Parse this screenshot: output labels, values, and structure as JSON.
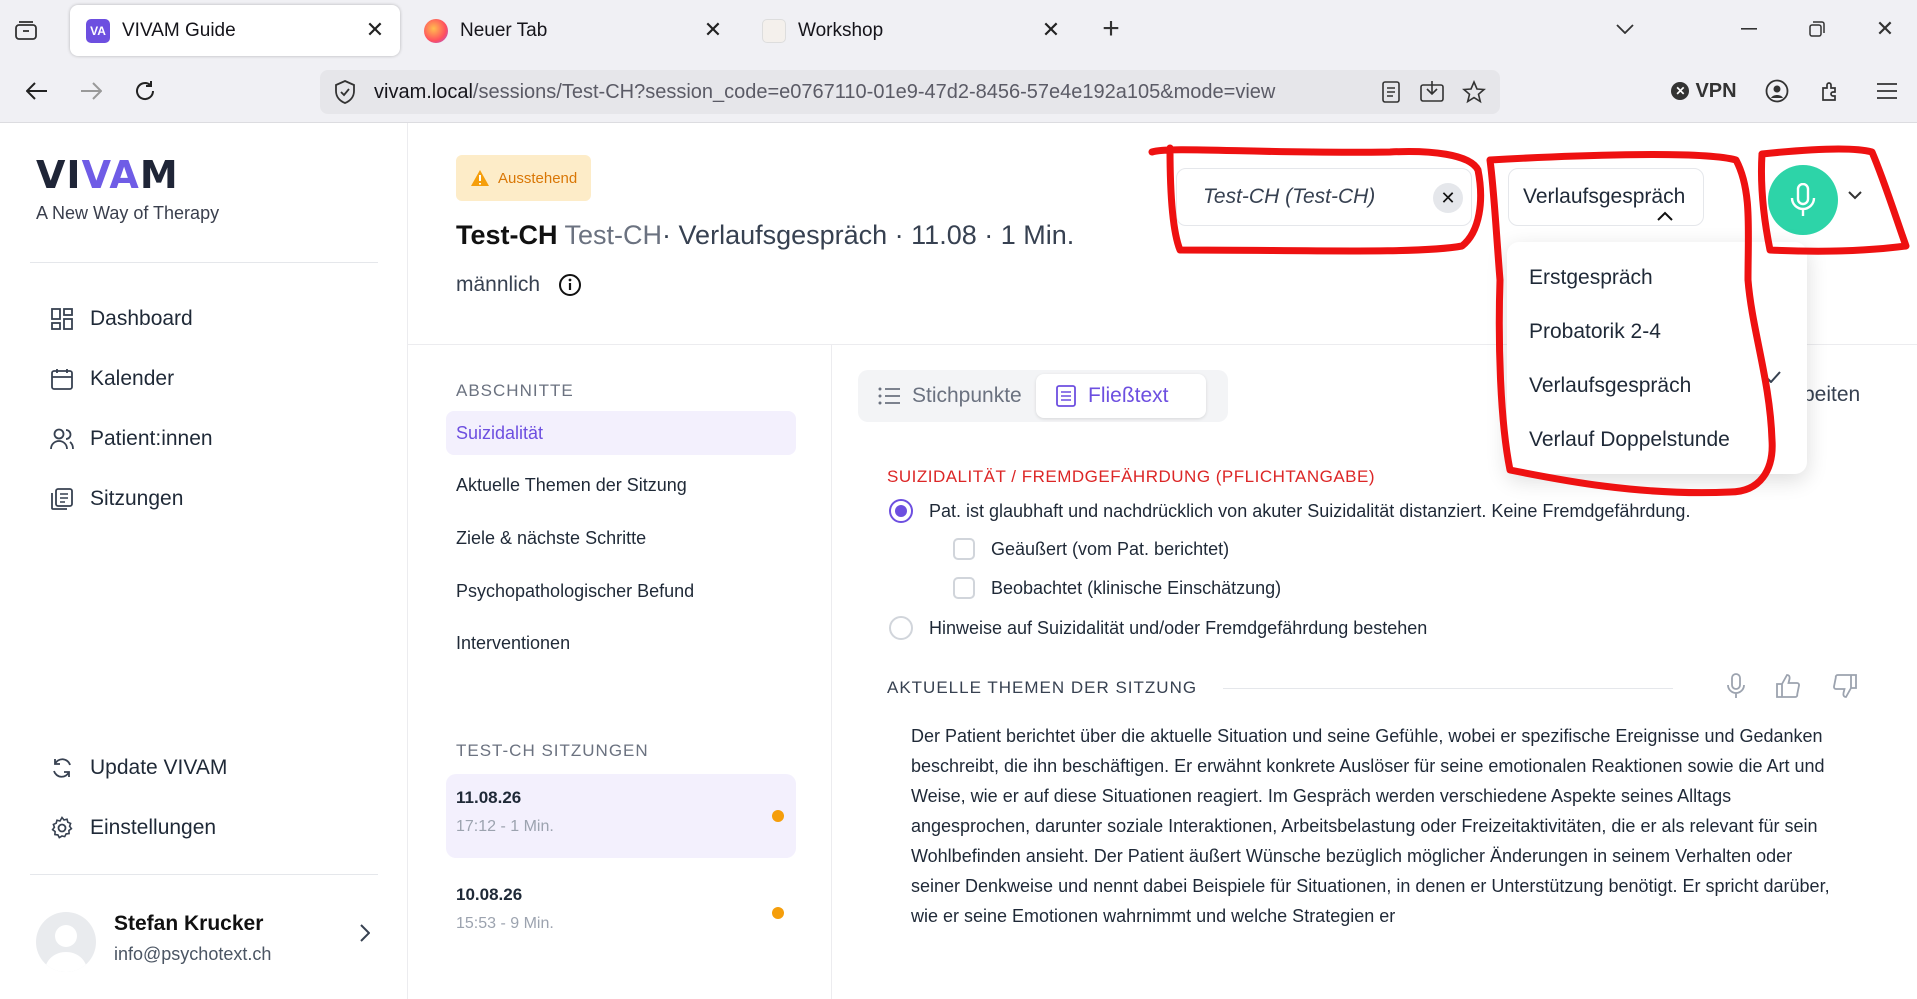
{
  "browser": {
    "tabs": [
      {
        "title": "VIVAM Guide",
        "active": true
      },
      {
        "title": "Neuer Tab",
        "active": false
      },
      {
        "title": "Workshop",
        "active": false
      }
    ],
    "url_host": "vivam.local",
    "url_path": "/sessions/Test-CH?session_code=e0767110-01e9-47d2-8456-57e4e192a105&mode=view",
    "vpn_label": "VPN"
  },
  "sidebar": {
    "logo": {
      "part1": "VI",
      "part2": "VA",
      "part3": "M"
    },
    "tagline": "A New Way of Therapy",
    "nav": [
      {
        "label": "Dashboard",
        "icon": "dashboard-icon"
      },
      {
        "label": "Kalender",
        "icon": "calendar-icon"
      },
      {
        "label": "Patient:innen",
        "icon": "users-icon"
      },
      {
        "label": "Sitzungen",
        "icon": "sessions-icon"
      }
    ],
    "bottom_nav": [
      {
        "label": "Update VIVAM",
        "icon": "refresh-icon"
      },
      {
        "label": "Einstellungen",
        "icon": "gear-icon"
      }
    ],
    "user": {
      "name": "Stefan Krucker",
      "email": "info@psychotext.ch"
    }
  },
  "header": {
    "status_badge": "Ausstehend",
    "patient_name": "Test-CH",
    "patient_code": "Test-CH",
    "meta": "· Verlaufsgespräch · 11.08 · 1 Min.",
    "gender": "männlich",
    "patient_select_value": "Test-CH (Test-CH)",
    "session_type_value": "Verlaufsgespräch",
    "session_type_options": [
      "Erstgespräch",
      "Probatorik 2-4",
      "Verlaufsgespräch",
      "Verlauf Doppelstunde"
    ],
    "selected_option_index": 2
  },
  "sections": {
    "heading": "ABSCHNITTE",
    "items": [
      "Suizidalität",
      "Aktuelle Themen der Sitzung",
      "Ziele & nächste Schritte",
      "Psychopathologischer Befund",
      "Interventionen"
    ],
    "active_index": 0,
    "sessions_heading": "TEST-CH SITZUNGEN",
    "sessions": [
      {
        "date": "11.08.26",
        "time": "17:12 - 1 Min."
      },
      {
        "date": "10.08.26",
        "time": "15:53 - 9 Min."
      }
    ]
  },
  "content": {
    "view_toggle": {
      "bullets": "Stichpunkte",
      "prose": "Fließtext",
      "active": "prose"
    },
    "edit_label": "beiten",
    "suizid_heading": "SUIZIDALITÄT / FREMDGEFÄHRDUNG (PFLICHTANGABE)",
    "radio_distanced": "Pat. ist glaubhaft und nachdrücklich von akuter Suizidalität distanziert. Keine Fremdgefährdung.",
    "check_reported": "Geäußert (vom Pat. berichtet)",
    "check_observed": "Beobachtet (klinische Einschätzung)",
    "radio_indications": "Hinweise auf Suizidalität und/oder Fremdgefährdung bestehen",
    "themen_heading": "AKTUELLE THEMEN DER SITZUNG",
    "themen_text": "Der Patient berichtet über die aktuelle Situation und seine Gefühle, wobei er spezifische Ereignisse und Gedanken beschreibt, die ihn beschäftigen. Er erwähnt konkrete Auslöser für seine emotionalen Reaktionen sowie die Art und Weise, wie er auf diese Situationen reagiert. Im Gespräch werden verschiedene Aspekte seines Alltags angesprochen, darunter soziale Interaktionen, Arbeitsbelastung oder Freizeitaktivitäten, die er als relevant für sein Wohlbefinden ansieht. Der Patient äußert Wünsche bezüglich möglicher Änderungen in seinem Verhalten oder seiner Denkweise und nennt dabei Beispiele für Situationen, in denen er Unterstützung benötigt. Er spricht darüber, wie er seine Emotionen wahrnimmt und welche Strategien er"
  },
  "colors": {
    "accent": "#6d4fe0",
    "mic": "#2dd4a8",
    "warning": "#d97706",
    "annotation": "#ee1111",
    "heading_red": "#dc2626"
  }
}
